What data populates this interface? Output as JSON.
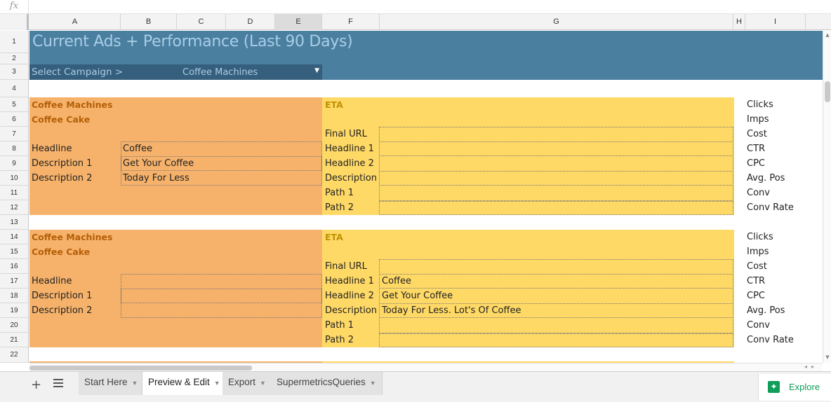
{
  "formula_bar": {
    "fx": "fx"
  },
  "columns": [
    "A",
    "B",
    "C",
    "D",
    "E",
    "F",
    "G",
    "H",
    "I"
  ],
  "rows": [
    "1",
    "2",
    "3",
    "4",
    "5",
    "6",
    "7",
    "8",
    "9",
    "10",
    "11",
    "12",
    "13",
    "14",
    "15",
    "16",
    "17",
    "18",
    "19",
    "20",
    "21",
    "22"
  ],
  "sheet": {
    "title": "Current Ads + Performance (Last 90 Days)",
    "select_label": "Select Campaign >",
    "select_value": "Coffee Machines",
    "select_arrow": "▼"
  },
  "ads": [
    {
      "campaign": "Coffee Machines",
      "adgroup": "Coffee Cake",
      "left_fields": [
        {
          "label": "Headline",
          "value": "Coffee"
        },
        {
          "label": "Description 1",
          "value": "Get Your Coffee"
        },
        {
          "label": "Description 2",
          "value": "Today For Less"
        }
      ],
      "eta_label": "ETA",
      "right_fields": [
        {
          "label": "Final URL",
          "value": ""
        },
        {
          "label": "Headline 1",
          "value": ""
        },
        {
          "label": "Headline 2",
          "value": ""
        },
        {
          "label": "Description",
          "value": ""
        },
        {
          "label": "Path 1",
          "value": ""
        },
        {
          "label": "Path 2",
          "value": ""
        }
      ],
      "metrics": [
        "Clicks",
        "Imps",
        "Cost",
        "CTR",
        "CPC",
        "Avg. Pos",
        "Conv",
        "Conv Rate"
      ]
    },
    {
      "campaign": "Coffee Machines",
      "adgroup": "Coffee Cake",
      "left_fields": [
        {
          "label": "Headline",
          "value": ""
        },
        {
          "label": "Description 1",
          "value": ""
        },
        {
          "label": "Description 2",
          "value": ""
        }
      ],
      "eta_label": "ETA",
      "right_fields": [
        {
          "label": "Final URL",
          "value": ""
        },
        {
          "label": "Headline 1",
          "value": "Coffee"
        },
        {
          "label": "Headline 2",
          "value": "Get Your Coffee"
        },
        {
          "label": "Description",
          "value": "Today For Less. Lot's Of Coffee"
        },
        {
          "label": "Path 1",
          "value": ""
        },
        {
          "label": "Path 2",
          "value": ""
        }
      ],
      "metrics": [
        "Clicks",
        "Imps",
        "Cost",
        "CTR",
        "CPC",
        "Avg. Pos",
        "Conv",
        "Conv Rate"
      ]
    }
  ],
  "tabs": [
    {
      "label": "Start Here",
      "active": false
    },
    {
      "label": "Preview & Edit",
      "active": true
    },
    {
      "label": "Export",
      "active": false
    },
    {
      "label": "SupermetricsQueries",
      "active": false
    }
  ],
  "toolbar": {
    "add_sheet": "+",
    "explore_label": "Explore"
  },
  "colors": {
    "banner": "#4a7fa0",
    "banner_dark": "#355f7c",
    "orange_block": "#f6b26b",
    "yellow_block": "#ffd966",
    "explore_green": "#0f9d58"
  }
}
